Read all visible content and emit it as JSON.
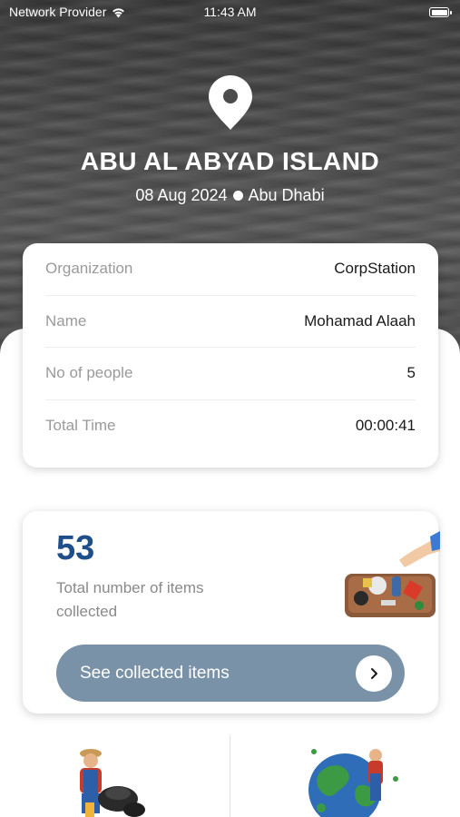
{
  "status_bar": {
    "carrier": "Network Provider",
    "time": "11:43 AM"
  },
  "header": {
    "title": "ABU AL ABYAD ISLAND",
    "date": "08 Aug 2024",
    "location": "Abu Dhabi"
  },
  "info": {
    "rows": [
      {
        "label": "Organization",
        "value": "CorpStation"
      },
      {
        "label": "Name",
        "value": "Mohamad Alaah"
      },
      {
        "label": "No of people",
        "value": "5"
      },
      {
        "label": "Total Time",
        "value": "00:00:41"
      }
    ]
  },
  "items": {
    "count": "53",
    "label": "Total number of items collected",
    "button_label": "See collected items"
  },
  "colors": {
    "accent_blue": "#1f4f8a",
    "button_bg": "#7a92a8"
  },
  "icons": [
    "wifi-icon",
    "battery-icon",
    "location-pin-icon",
    "chevron-right-icon"
  ]
}
